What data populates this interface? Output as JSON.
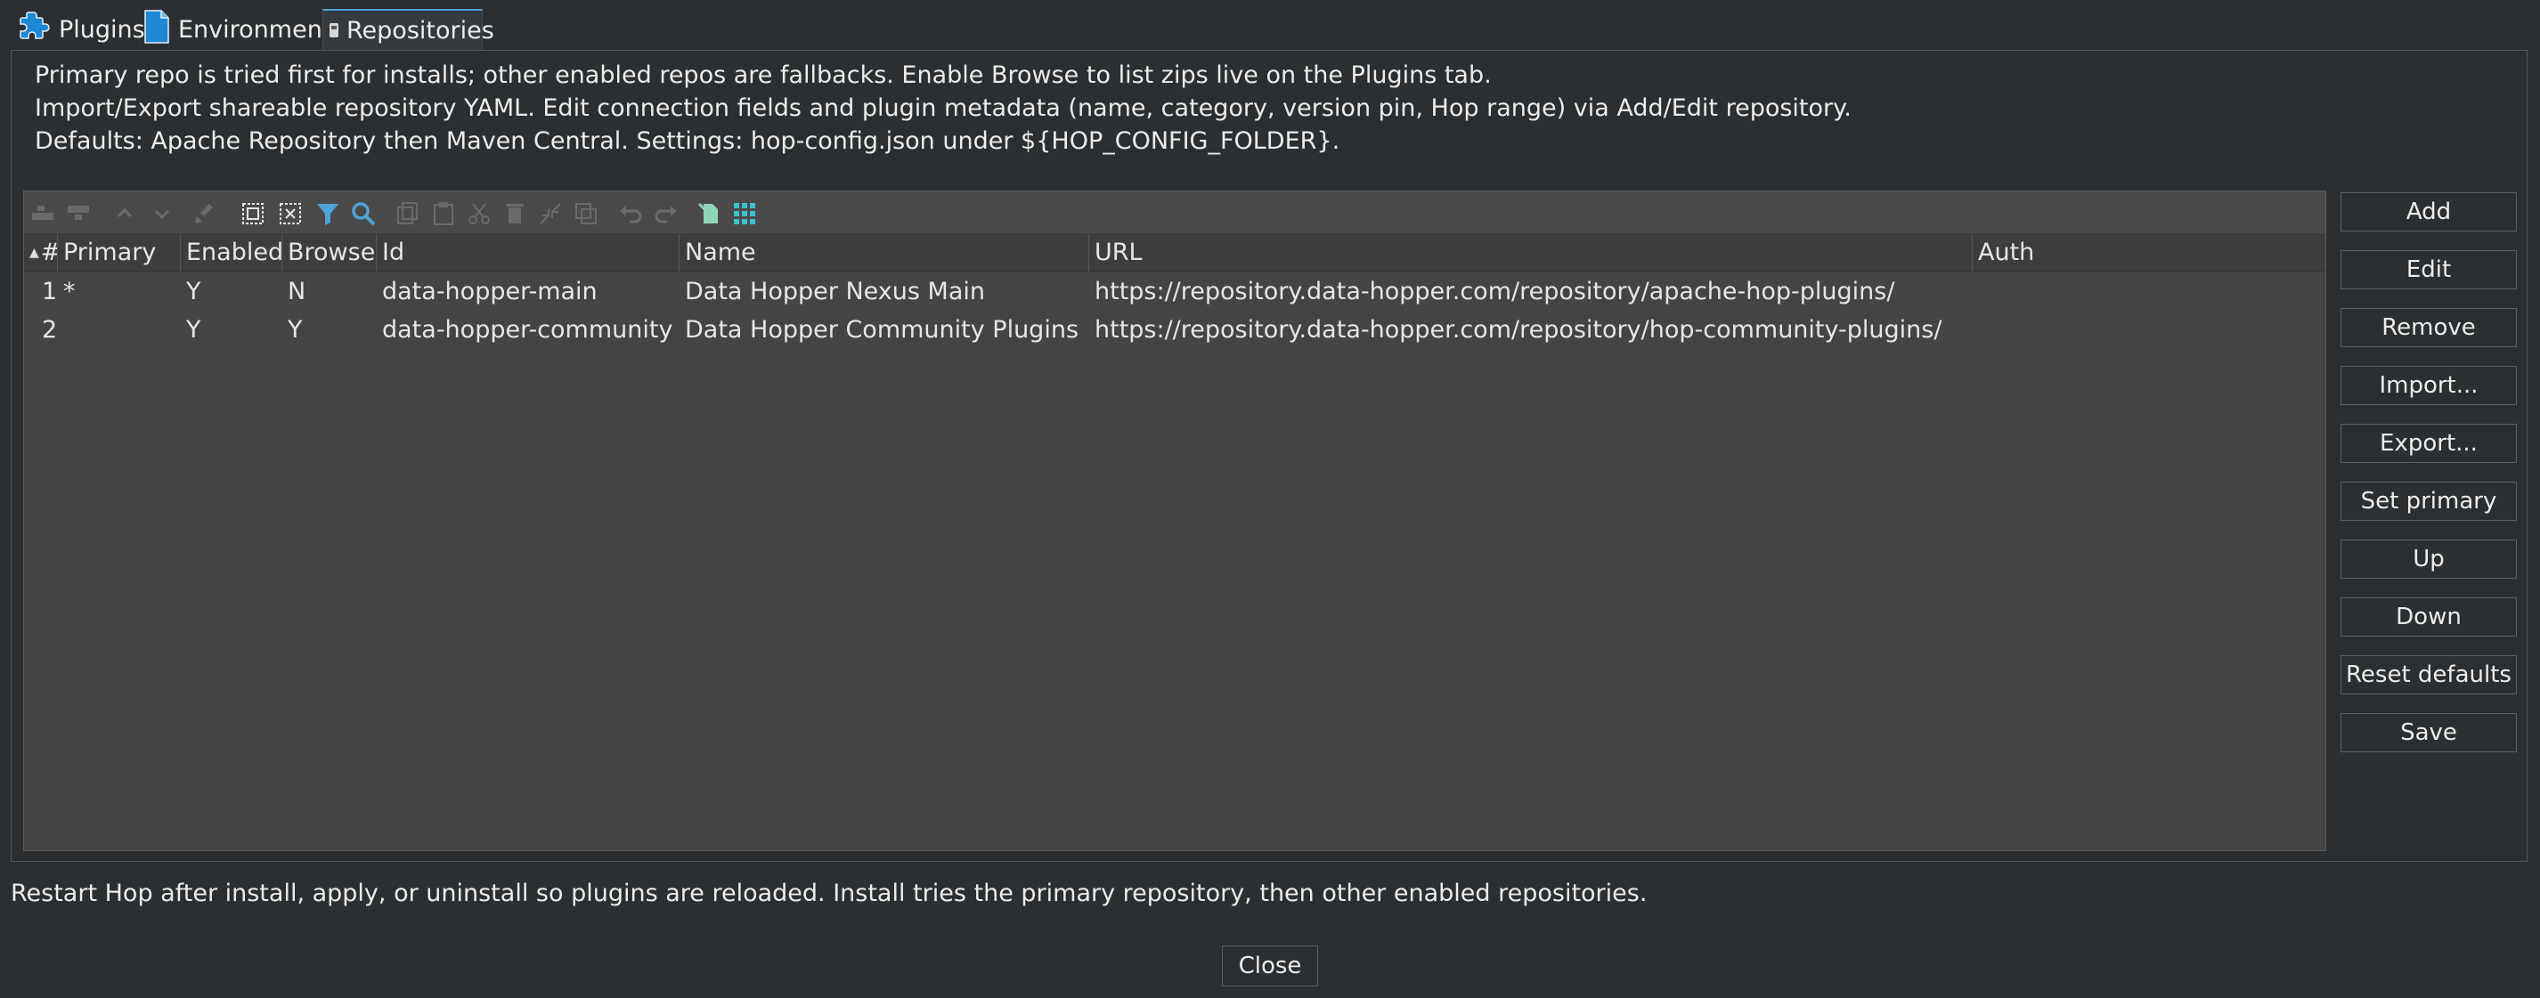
{
  "tabs": [
    {
      "label": "Plugins"
    },
    {
      "label": "Environment"
    },
    {
      "label": "Repositories"
    }
  ],
  "description": [
    "Primary repo is tried first for installs; other enabled repos are fallbacks. Enable Browse to list zips live on the Plugins tab.",
    "Import/Export shareable repository YAML. Edit connection fields and plugin metadata (name, category, version pin, Hop range) via Add/Edit repository.",
    "Defaults: Apache Repository then Maven Central. Settings: hop-config.json under ${HOP_CONFIG_FOLDER}."
  ],
  "toolbar_icons": [
    "insert-row-before-icon",
    "insert-row-after-icon",
    "move-up-icon",
    "move-down-icon",
    "clear-icon",
    "select-all-icon",
    "unselect-all-icon",
    "filter-icon",
    "search-icon",
    "copy-icon",
    "paste-icon",
    "cut-icon",
    "delete-icon",
    "collapse-icon",
    "duplicate-icon",
    "undo-icon",
    "redo-icon",
    "keep-rows-icon",
    "optimal-width-icon"
  ],
  "table": {
    "columns": [
      "#",
      "Primary",
      "Enabled",
      "Browse",
      "Id",
      "Name",
      "URL",
      "Auth"
    ],
    "rows": [
      {
        "num": "1",
        "primary": "*",
        "enabled": "Y",
        "browse": "N",
        "id": "data-hopper-main",
        "name": "Data Hopper Nexus Main",
        "url": "https://repository.data-hopper.com/repository/apache-hop-plugins/",
        "auth": ""
      },
      {
        "num": "2",
        "primary": "",
        "enabled": "Y",
        "browse": "Y",
        "id": "data-hopper-community",
        "name": "Data Hopper Community Plugins",
        "url": "https://repository.data-hopper.com/repository/hop-community-plugins/",
        "auth": ""
      }
    ]
  },
  "side_buttons": {
    "add": "Add",
    "edit": "Edit",
    "remove": "Remove",
    "import": "Import...",
    "export": "Export...",
    "set_primary": "Set primary",
    "up": "Up",
    "down": "Down",
    "reset_defaults": "Reset defaults",
    "save": "Save"
  },
  "footer": {
    "text": "Restart Hop after install, apply, or uninstall so plugins are reloaded. Install tries the primary repository, then other enabled repositories.",
    "close_label": "Close"
  },
  "colors": {
    "background": "#2c2f31",
    "table_background": "#444444",
    "tab_accent": "#4ea3d8",
    "highlight_icon": "#8fd6b8"
  }
}
